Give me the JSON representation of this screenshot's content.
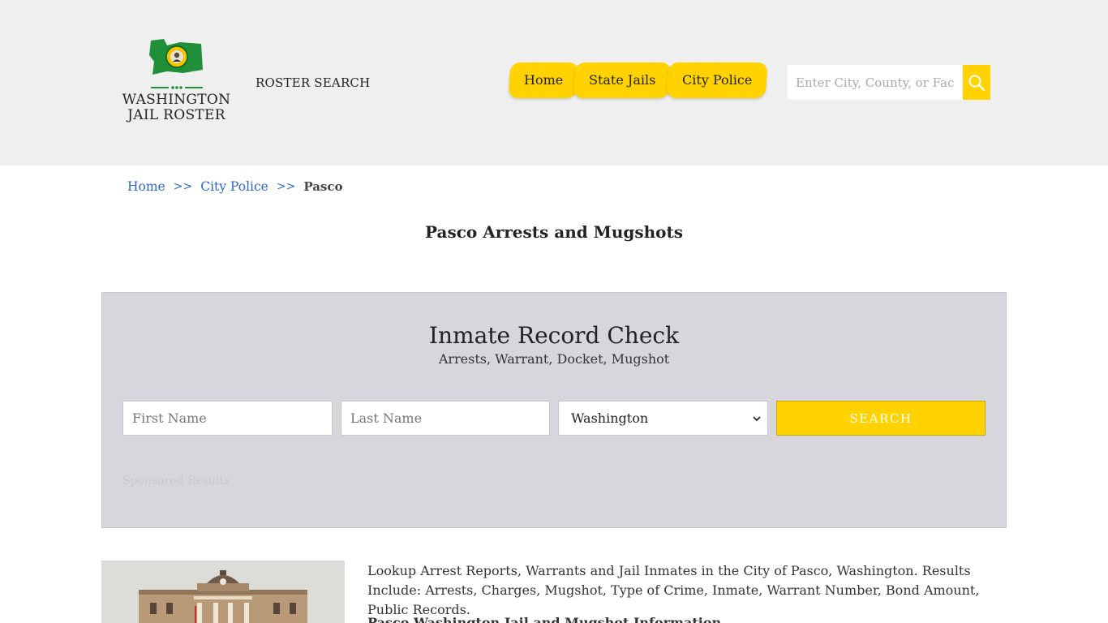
{
  "header": {
    "logo": {
      "line1": "WASHINGTON",
      "line2": "JAIL ROSTER"
    },
    "roster_search": "ROSTER SEARCH",
    "nav": [
      "Home",
      "State Jails",
      "City Police"
    ],
    "search": {
      "placeholder": "Enter City, County, or Facility"
    }
  },
  "breadcrumb": {
    "items": [
      "Home",
      "City Police"
    ],
    "separator": ">>",
    "current": "Pasco"
  },
  "page_title": "Pasco Arrests and Mugshots",
  "record_check": {
    "title": "Inmate Record Check",
    "subtitle": "Arrests, Warrant, Docket, Mugshot",
    "first_name_placeholder": "First Name",
    "last_name_placeholder": "Last Name",
    "state_selected": "Washington",
    "search_label": "SEARCH",
    "sponsored": "Sponsored Results"
  },
  "content": {
    "intro": "Lookup Arrest Reports, Warrants and Jail Inmates in the City of Pasco, Washington. Results Include: Arrests, Charges, Mugshot, Type of Crime, Inmate, Warrant Number, Bond Amount, Public Records.",
    "subheading": "Pasco Washington Jail and Mugshot Information"
  },
  "colors": {
    "accent": "#ffd200",
    "header_bg": "#efefef",
    "panel_bg": "#d6d6dc",
    "link": "#2b66c7",
    "flag_green": "#1f8f3a"
  }
}
